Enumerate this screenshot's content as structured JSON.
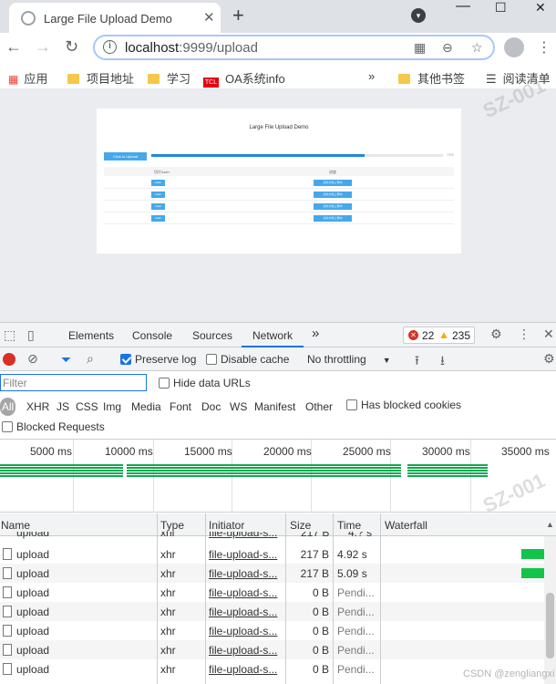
{
  "browser": {
    "tab_title": "Large File Upload Demo",
    "new_tab": "+",
    "close_tab": "✕",
    "url_host": "localhost",
    "url_rest": ":9999/upload",
    "bookmarks": [
      "应用",
      "项目地址",
      "学习",
      "OA系统info",
      "»",
      "其他书签",
      "阅读清单"
    ],
    "tcl_badge": "TCL"
  },
  "page": {
    "title": "Large File Upload Demo",
    "upload_button": "Click to Upload",
    "progress_percent": 73,
    "progress_label": "73%",
    "table_headers": [
      "切片hash",
      "进度"
    ],
    "rows": [
      {
        "hash": "hash",
        "progress": "切片文件上传中"
      },
      {
        "hash": "hash",
        "progress": "切片文件上传中"
      },
      {
        "hash": "hash",
        "progress": "切片文件上传中"
      },
      {
        "hash": "hash",
        "progress": "切片文件上传中"
      }
    ]
  },
  "devtools": {
    "tabs": [
      "Elements",
      "Console",
      "Sources",
      "Network"
    ],
    "active_tab": "Network",
    "more_tabs": "»",
    "errors": "22",
    "warnings": "235",
    "preserve_log": "Preserve log",
    "disable_cache": "Disable cache",
    "throttling": "No throttling",
    "filter_placeholder": "Filter",
    "hide_data_urls": "Hide data URLs",
    "type_all": "All",
    "types": [
      "XHR",
      "JS",
      "CSS",
      "Img",
      "Media",
      "Font",
      "Doc",
      "WS",
      "Manifest",
      "Other"
    ],
    "has_blocked_cookies": "Has blocked cookies",
    "blocked_requests": "Blocked Requests",
    "timeline_ticks": [
      "5000 ms",
      "10000 ms",
      "15000 ms",
      "20000 ms",
      "25000 ms",
      "30000 ms",
      "35000 ms"
    ],
    "columns": [
      "Name",
      "Type",
      "Initiator",
      "Size",
      "Time",
      "Waterfall"
    ],
    "requests": [
      {
        "name": "upload",
        "type": "xhr",
        "initiator": "file-upload-s...",
        "size": "217 B",
        "time": "4.92 s",
        "status": "done"
      },
      {
        "name": "upload",
        "type": "xhr",
        "initiator": "file-upload-s...",
        "size": "217 B",
        "time": "5.09 s",
        "status": "done"
      },
      {
        "name": "upload",
        "type": "xhr",
        "initiator": "file-upload-s...",
        "size": "0 B",
        "time": "Pendi...",
        "status": "pending"
      },
      {
        "name": "upload",
        "type": "xhr",
        "initiator": "file-upload-s...",
        "size": "0 B",
        "time": "Pendi...",
        "status": "pending"
      },
      {
        "name": "upload",
        "type": "xhr",
        "initiator": "file-upload-s...",
        "size": "0 B",
        "time": "Pendi...",
        "status": "pending"
      },
      {
        "name": "upload",
        "type": "xhr",
        "initiator": "file-upload-s...",
        "size": "0 B",
        "time": "Pendi...",
        "status": "pending"
      },
      {
        "name": "upload",
        "type": "xhr",
        "initiator": "file-upload-s...",
        "size": "0 B",
        "time": "Pendi...",
        "status": "pending"
      }
    ],
    "partial_row": {
      "name": "upload",
      "type": "xhr",
      "initiator": "file-upload-s...",
      "size": "217 B",
      "time": "4.? s"
    }
  },
  "watermark": "SZ-001",
  "credit": "CSDN @zengliangxi",
  "colors": {
    "accent": "#1a73e8",
    "waterfall": "#13c44a",
    "upload_blue": "#45a8ea"
  }
}
